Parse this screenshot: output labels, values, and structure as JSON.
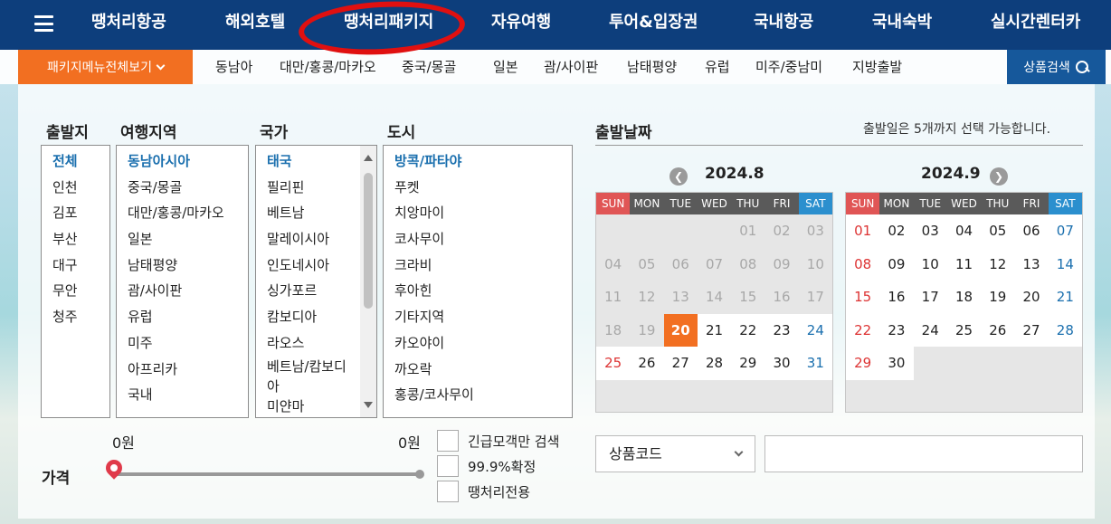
{
  "topnav": {
    "items": [
      "땡처리항공",
      "해외호텔",
      "땡처리패키지",
      "자유여행",
      "투어&입장권",
      "국내항공",
      "국내숙박",
      "실시간렌터카"
    ]
  },
  "subnav": {
    "menu_label": "패키지메뉴전체보기",
    "items": [
      "동남아",
      "대만/홍콩/마카오",
      "중국/몽골",
      "일본",
      "괌/사이판",
      "남태평양",
      "유럽",
      "미주/중남미",
      "지방출발"
    ],
    "search_label": "상품검색"
  },
  "filters": {
    "departure": {
      "title": "출발지",
      "options": [
        "전체",
        "인천",
        "김포",
        "부산",
        "대구",
        "무안",
        "청주"
      ],
      "selected": "전체"
    },
    "region": {
      "title": "여행지역",
      "options": [
        "동남아시아",
        "중국/몽골",
        "대만/홍콩/마카오",
        "일본",
        "남태평양",
        "괌/사이판",
        "유럽",
        "미주",
        "아프리카",
        "국내"
      ],
      "selected": "동남아시아"
    },
    "country": {
      "title": "국가",
      "options": [
        "태국",
        "필리핀",
        "베트남",
        "말레이시아",
        "인도네시아",
        "싱가포르",
        "캄보디아",
        "라오스",
        "베트남/캄보디",
        "아",
        "미얀마"
      ],
      "selected": "태국"
    },
    "city": {
      "title": "도시",
      "options": [
        "방콕/파타야",
        "푸켓",
        "치앙마이",
        "코사무이",
        "크라비",
        "후아힌",
        "기타지역",
        "카오야이",
        "까오락",
        "홍콩/코사무이"
      ],
      "selected": "방콕/파타야"
    }
  },
  "dates": {
    "title": "출발날짜",
    "note": "출발일은 5개까지 선택 가능합니다.",
    "dow": [
      "SUN",
      "MON",
      "TUE",
      "WED",
      "THU",
      "FRI",
      "SAT"
    ],
    "prev_icon": "chevron-left-icon",
    "next_icon": "chevron-right-icon",
    "aug": {
      "label": "2024.8",
      "today": "20",
      "weeks": [
        [
          "",
          "",
          "",
          "",
          "01",
          "02",
          "03"
        ],
        [
          "04",
          "05",
          "06",
          "07",
          "08",
          "09",
          "10"
        ],
        [
          "11",
          "12",
          "13",
          "14",
          "15",
          "16",
          "17"
        ],
        [
          "18",
          "19",
          "20",
          "21",
          "22",
          "23",
          "24"
        ],
        [
          "25",
          "26",
          "27",
          "28",
          "29",
          "30",
          "31"
        ]
      ]
    },
    "sep": {
      "label": "2024.9",
      "weeks": [
        [
          "01",
          "02",
          "03",
          "04",
          "05",
          "06",
          "07"
        ],
        [
          "08",
          "09",
          "10",
          "11",
          "12",
          "13",
          "14"
        ],
        [
          "15",
          "16",
          "17",
          "18",
          "19",
          "20",
          "21"
        ],
        [
          "22",
          "23",
          "24",
          "25",
          "26",
          "27",
          "28"
        ],
        [
          "29",
          "30",
          "",
          "",
          "",
          "",
          ""
        ]
      ]
    }
  },
  "price": {
    "label": "가격",
    "min": "0원",
    "max": "0원"
  },
  "checkboxes": [
    "긴급모객만 검색",
    "99.9%확정",
    "땡처리전용"
  ],
  "product_code": {
    "select_label": "상품코드",
    "input_value": ""
  },
  "colors": {
    "nav_bg": "#0d3e7c",
    "accent_orange": "#f26f21",
    "search_blue": "#16589b",
    "highlight_red": "#e01010"
  }
}
